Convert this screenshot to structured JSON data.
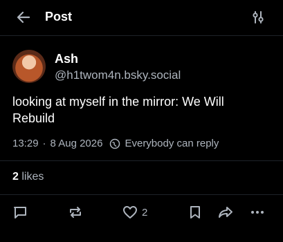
{
  "header": {
    "title": "Post"
  },
  "author": {
    "display_name": "Ash",
    "handle": "@h1twom4n.bsky.social"
  },
  "post": {
    "text": "looking at myself in the mirror: We Will Rebuild",
    "time": "13:29",
    "date": "8 Aug 2026",
    "separator": "·",
    "reply_setting": "Everybody can reply"
  },
  "stats": {
    "likes_count": "2",
    "likes_label": "likes"
  },
  "actions": {
    "like_count": "2"
  },
  "colors": {
    "background": "#000000",
    "text": "#ffffff",
    "muted": "#aeb5be",
    "divider": "#1e2329"
  }
}
